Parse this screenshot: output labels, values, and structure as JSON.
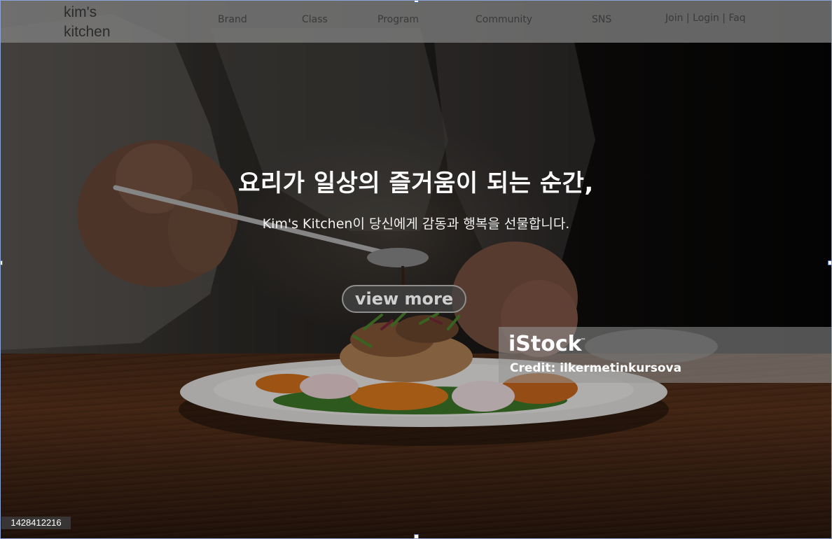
{
  "nav": {
    "logo_line1": "kim's",
    "logo_line2": "kitchen",
    "links": [
      {
        "label": "Brand"
      },
      {
        "label": "Class"
      },
      {
        "label": "Program"
      },
      {
        "label": "Community"
      },
      {
        "label": "SNS"
      }
    ],
    "auth_label": "Join | Login | Faq"
  },
  "hero": {
    "headline": "요리가 일상의 즐거움이 되는 순간,",
    "subline": "Kim's Kitchen이 당신에게 감동과 행복을 선물합니다.",
    "cta_label": "view more"
  },
  "watermark": {
    "brand": "iStock",
    "trademark": "™",
    "credit": "Credit: ilkermetinkursova",
    "image_id": "1428412216"
  },
  "colors": {
    "nav_bar": "#808080",
    "headline_text": "#ffffff",
    "cta_text": "#cfcfcf",
    "cta_border": "#8e8e8e"
  }
}
